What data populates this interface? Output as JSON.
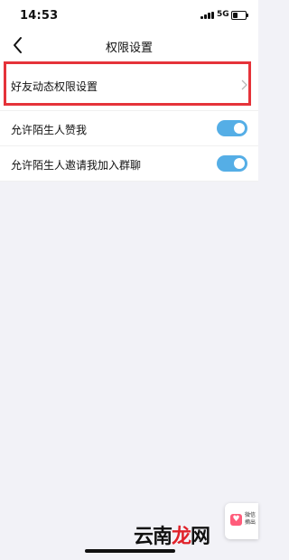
{
  "status": {
    "time": "14:53",
    "network": "5G"
  },
  "nav": {
    "title": "权限设置"
  },
  "rows": [
    {
      "label": "好友动态权限设置"
    },
    {
      "label": "允许陌生人赞我"
    },
    {
      "label": "允许陌生人邀请我加入群聊"
    }
  ],
  "float_card": {
    "line1": "微信",
    "line2": "摘出"
  },
  "watermark": {
    "part1": "云南",
    "part2": "龙",
    "part3": "网"
  },
  "colors": {
    "toggle_on": "#55aee6",
    "highlight": "#e5333a",
    "background": "#f2f2f7"
  }
}
